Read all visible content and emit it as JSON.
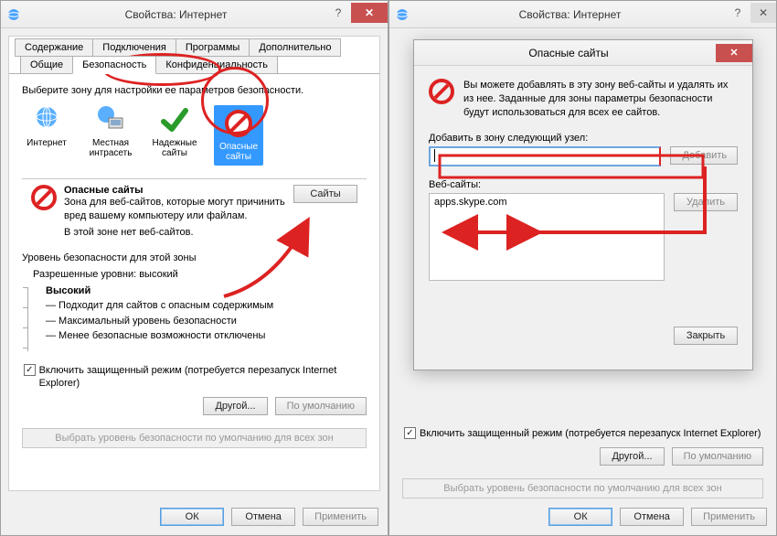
{
  "left": {
    "window_title": "Свойства: Интернет",
    "tabs_row1": [
      "Содержание",
      "Подключения",
      "Программы",
      "Дополнительно"
    ],
    "tabs_row2": [
      "Общие",
      "Безопасность",
      "Конфиденциальность"
    ],
    "select_zone_text": "Выберите зону для настройки ее параметров безопасности.",
    "zones": {
      "internet": "Интернет",
      "intranet": "Местная\nинтрасеть",
      "trusted": "Надежные\nсайты",
      "restricted": "Опасные\nсайты"
    },
    "restricted_heading": "Опасные сайты",
    "restricted_desc": "Зона для веб-сайтов, которые могут причинить вред вашему компьютеру или файлам.",
    "restricted_empty": "В этой зоне нет веб-сайтов.",
    "sites_button": "Сайты",
    "level_heading": "Уровень безопасности для этой зоны",
    "allowed_levels": "Разрешенные уровни: высокий",
    "level_name": "Высокий",
    "level_line1": "— Подходит для сайтов с опасным содержимым",
    "level_line2": "— Максимальный уровень безопасности",
    "level_line3": "— Менее безопасные возможности отключены",
    "protected_mode": "Включить защищенный режим (потребуется перезапуск Internet Explorer)",
    "custom_button": "Другой...",
    "default_level_button": "По умолчанию",
    "reset_all": "Выбрать уровень безопасности по умолчанию для всех зон",
    "ok": "ОК",
    "cancel": "Отмена",
    "apply": "Применить"
  },
  "right": {
    "window_title": "Свойства: Интернет",
    "dialog_title": "Опасные сайты",
    "dialog_info": "Вы можете добавлять в эту зону  веб-сайты и удалять их из нее. Заданные для зоны параметры безопасности будут использоваться для всех ее сайтов.",
    "add_label": "Добавить в зону следующий узел:",
    "add_value": "",
    "add_button": "Добавить",
    "websites_label": "Веб-сайты:",
    "website_item": "apps.skype.com",
    "delete_button": "Удалить",
    "close_button": "Закрыть"
  }
}
